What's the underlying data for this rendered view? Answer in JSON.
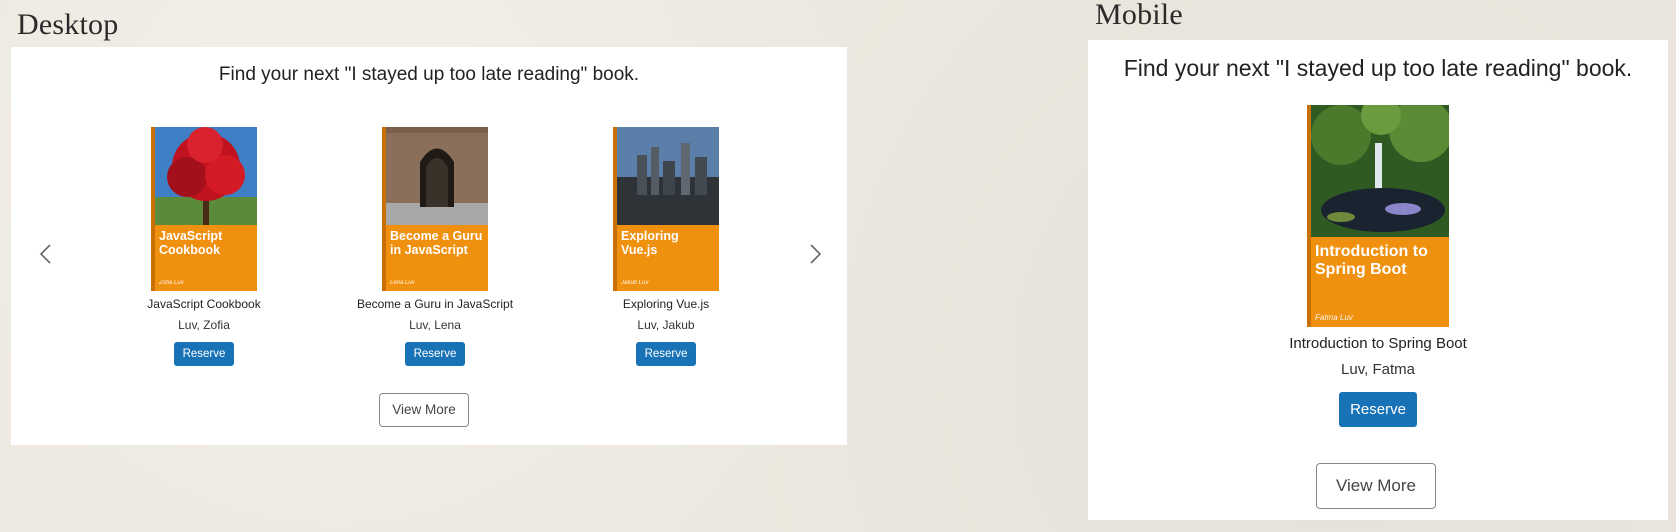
{
  "labels": {
    "desktop": "Desktop",
    "mobile": "Mobile"
  },
  "desktop": {
    "heading": "Find your next \"I stayed up too late reading\" book.",
    "books": [
      {
        "title": "JavaScript Cookbook",
        "cover_title": "JavaScript Cookbook",
        "cover_author": "Zofia Luv",
        "author": "Luv, Zofia",
        "reserve": "Reserve",
        "photo": "red-tree"
      },
      {
        "title": "Become a Guru in JavaScript",
        "cover_title": "Become a Guru in JavaScript",
        "cover_author": "Lena Luv",
        "author": "Luv, Lena",
        "reserve": "Reserve",
        "photo": "stone-archway"
      },
      {
        "title": "Exploring Vue.js",
        "cover_title": "Exploring Vue.js",
        "cover_author": "Jakub Luv",
        "author": "Luv, Jakub",
        "reserve": "Reserve",
        "photo": "city-skyline"
      }
    ],
    "view_more": "View More",
    "prev_icon": "chevron-left-icon",
    "next_icon": "chevron-right-icon"
  },
  "mobile": {
    "heading": "Find your next \"I stayed up too late reading\" book.",
    "book": {
      "title": "Introduction to Spring Boot",
      "cover_title": "Introduction to Spring Boot",
      "cover_author": "Fatma Luv",
      "author": "Luv, Fatma",
      "reserve": "Reserve",
      "photo": "garden-waterfall"
    },
    "view_more": "View More"
  },
  "colors": {
    "accent": "#1772b6",
    "cover_orange": "#f0900f",
    "panel": "#ffffff",
    "background": "#ece8df"
  }
}
